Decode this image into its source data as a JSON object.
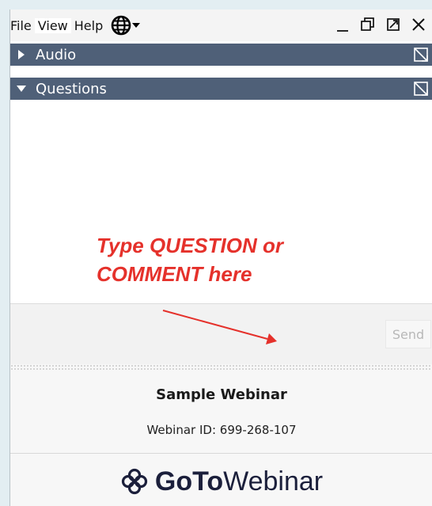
{
  "menu": {
    "file": "File",
    "view": "View",
    "help": "Help"
  },
  "sections": {
    "audio": "Audio",
    "questions": "Questions"
  },
  "annotation": {
    "line1": "Type QUESTION or",
    "line2": "COMMENT here"
  },
  "input": {
    "send_label": "Send"
  },
  "webinar": {
    "title": "Sample Webinar",
    "id_text": "Webinar ID: 699-268-107",
    "logo_bold": "GoTo",
    "logo_light": "Webinar"
  },
  "colors": {
    "header": "#4f6078",
    "annotation": "#e5312b",
    "background": "#e3eef2"
  },
  "icons": [
    "globe-icon",
    "minimize-icon",
    "restore-icon",
    "popout-icon",
    "close-icon",
    "expand-triangle-icon",
    "collapse-triangle-icon",
    "gotowebinar-logo-icon"
  ]
}
